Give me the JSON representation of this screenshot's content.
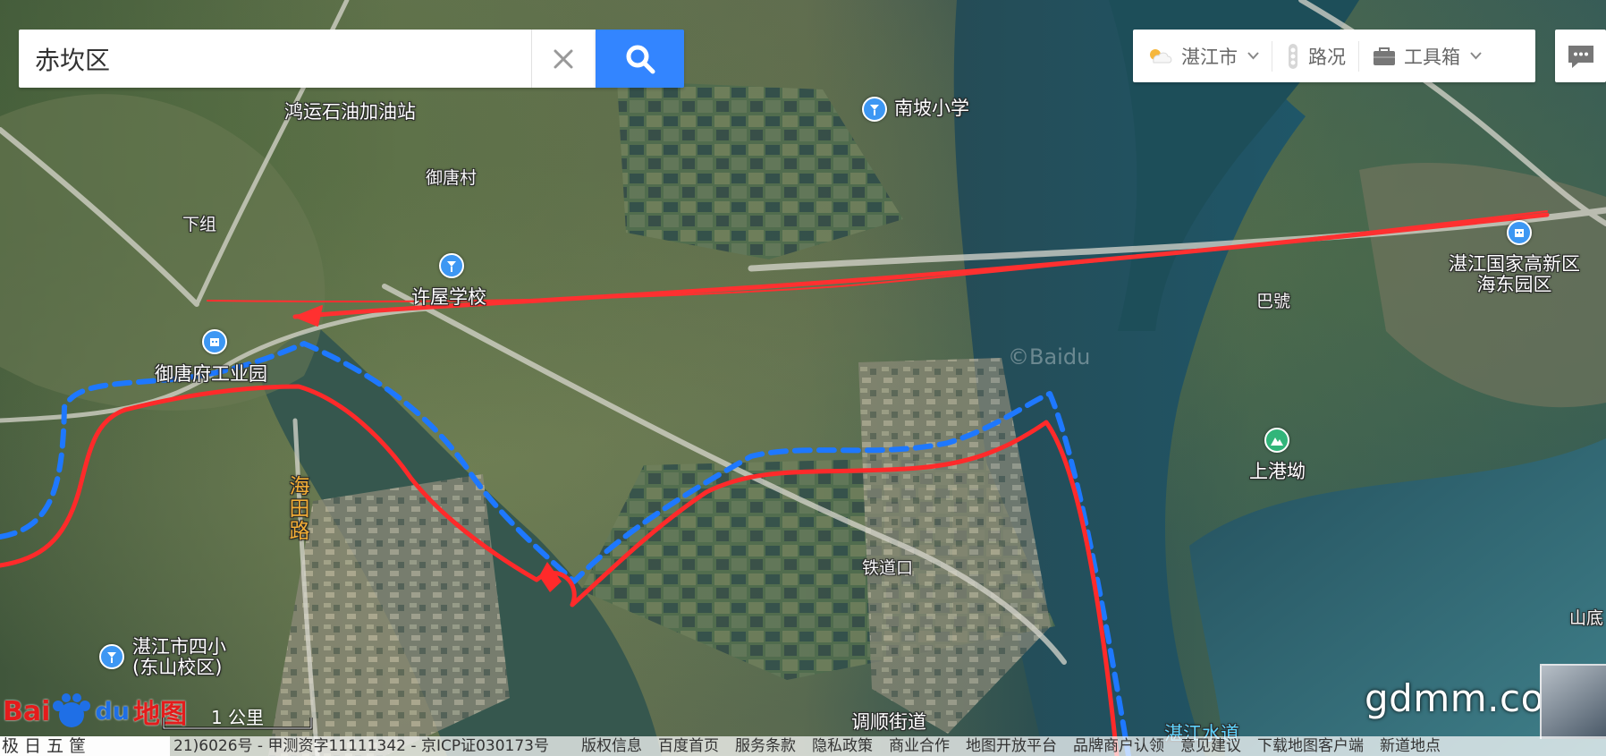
{
  "search": {
    "query": "赤坎区"
  },
  "toolbar": {
    "city": "湛江市",
    "traffic": "路况",
    "tools": "工具箱"
  },
  "labels": {
    "gas_station": "鸿运石油加油站",
    "nanpo_school": "南坡小学",
    "village1": "御唐村",
    "xiazu": "下组",
    "xuwu_school": "许屋学校",
    "yutangfu": "御唐府工业园",
    "haitian_road": "海田路",
    "tiedaokou": "铁道口",
    "sixiao": "湛江市四小\n(东山校区)",
    "diaoshun": "调顺街道",
    "zhanjiang_park": "湛江国家高新区\n海东园区",
    "shanggang": "上港坳",
    "bahao": "巴號",
    "shuidao": "湛江水道",
    "shandi": "山底",
    "waterlabel": "湛江"
  },
  "watermark": "©Baidu",
  "scale": "1 公里",
  "baidu": {
    "bai": "Bai",
    "du": "du",
    "map": "地图"
  },
  "footer": {
    "left": "极 日 五 筐",
    "copyright": "21)6026号 - 甲测资字11111342 - 京ICP证030173号",
    "links": [
      "版权信息",
      "百度首页",
      "服务条款",
      "隐私政策",
      "商业合作",
      "地图开放平台",
      "品牌商户认领",
      "意见建议",
      "下载地图客户端",
      "新道地点"
    ]
  },
  "site_watermark": "gdmm.com",
  "colors": {
    "accent": "#3385ff",
    "route_red": "#e53935",
    "route_blue": "#1e78ff",
    "poi_blue": "#3d97f3",
    "poi_green": "#31b57a"
  }
}
